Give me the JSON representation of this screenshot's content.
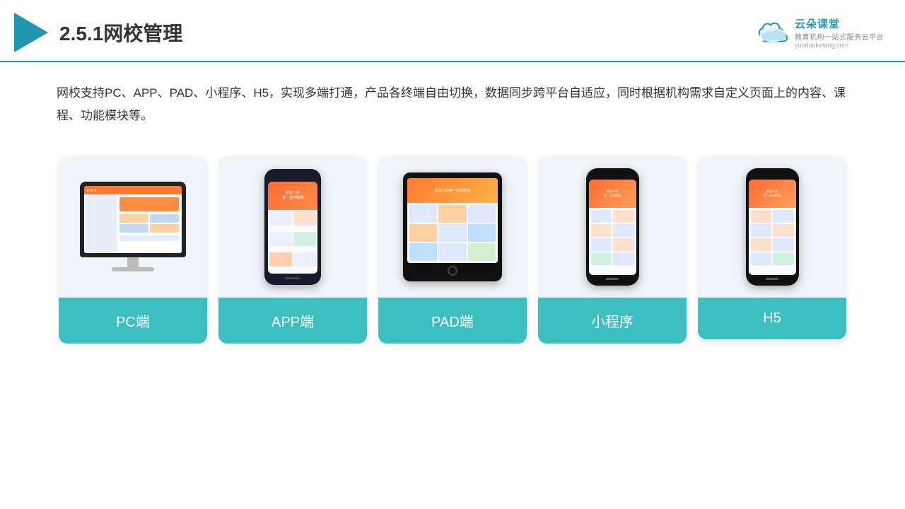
{
  "header": {
    "title": "2.5.1网校管理",
    "brand": {
      "name": "云朵课堂",
      "url": "yunduoketang.com",
      "tagline": "教育机构一站",
      "tagline2": "式服务云平台"
    }
  },
  "description": {
    "text": "网校支持PC、APP、PAD、小程序、H5，实现多端打通，产品各终端自由切换，数据同步跨平台自适应，同时根据机构需求自定义页面上的内容、课程、功能模块等。"
  },
  "cards": [
    {
      "id": "pc",
      "label": "PC端"
    },
    {
      "id": "app",
      "label": "APP端"
    },
    {
      "id": "pad",
      "label": "PAD端"
    },
    {
      "id": "miniprogram",
      "label": "小程序"
    },
    {
      "id": "h5",
      "label": "H5"
    }
  ],
  "colors": {
    "accent": "#2196b0",
    "teal": "#3dbfbf",
    "card_bg": "#edf2f7"
  }
}
